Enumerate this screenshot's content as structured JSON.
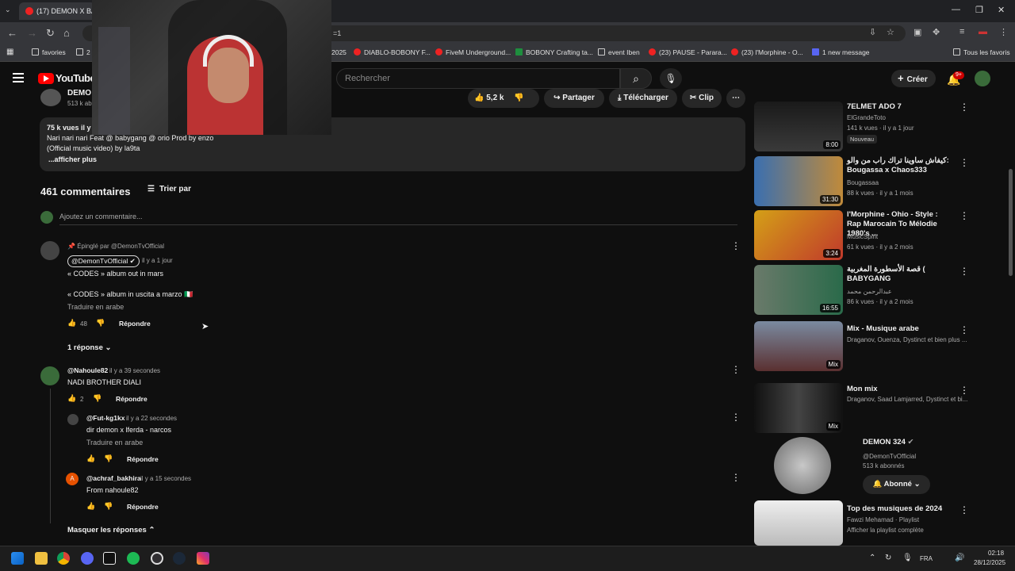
{
  "browser": {
    "tab_title": "(17) DEMON X BAB",
    "url_fragment": "=1",
    "bookmarks": [
      {
        "label": "favories"
      },
      {
        "label": "2"
      },
      {
        "label": "2025"
      },
      {
        "label": "DIABLO-BOBONY F..."
      },
      {
        "label": "FiveM Underground..."
      },
      {
        "label": "BOBONY Crafting ta..."
      },
      {
        "label": "event Iben"
      },
      {
        "label": "(23) PAUSE - Parara..."
      },
      {
        "label": "(23) l'Morphine - O..."
      },
      {
        "label": "1 new message"
      },
      {
        "label": "Tous les favoris"
      }
    ]
  },
  "youtube": {
    "logo_text": "YouTube",
    "search_placeholder": "Rechercher",
    "create_label": "Créer",
    "notif_badge": "9+"
  },
  "video": {
    "channel_partial": "DEMO",
    "subs_partial": "513 k ab",
    "likes": "5,2 k",
    "share_label": "Partager",
    "download_label": "Télécharger",
    "clip_label": "Clip",
    "views_partial": "75 k vues   il y",
    "desc_line1": "Nari nari nari Feat @ babygang  @ orio Prod by enzo",
    "desc_line2": "(Official music video) by la9ta",
    "more_label": "...afficher plus"
  },
  "comments": {
    "count_label": "461 commentaires",
    "sort_label": "Trier par",
    "add_placeholder": "Ajoutez un commentaire...",
    "pinned_label": "Épinglé par @DemonTvOfficial",
    "c1_author": "@DemonTvOfficial",
    "c1_time": "il y a 1 jour",
    "c1_line1": "« CODES » album out in mars",
    "c1_line2": "« CODES » album in uscita a marzo 🇮🇹",
    "c1_translate": "Traduire en arabe",
    "c1_likes": "48",
    "reply_label": "Répondre",
    "c1_replies": "1 réponse",
    "c2_author": "@Nahoule82",
    "c2_time": "il y a 39 secondes",
    "c2_text": "NADI BROTHER DIALI",
    "c2_likes": "2",
    "r1_author": "@Fut-kg1kx",
    "r1_time": "il y a 22 secondes",
    "r1_text": "dir demon x lferda - narcos",
    "r1_translate": "Traduire en arabe",
    "r2_author": "@achraf_bakhira",
    "r2_time": "il y a 15 secondes",
    "r2_text": "From nahoule82",
    "r2_avatar_letter": "A",
    "hide_replies": "Masquer les réponses"
  },
  "sidebar": [
    {
      "title": "7ELMET ADO 7",
      "channel": "ElGrandeToto",
      "meta": "141 k vues · il y a 1 jour",
      "duration": "8:00",
      "badge": "Nouveau"
    },
    {
      "title": "كيفاش ساوينا تراك راب من والو: Bougassa x Chaos333",
      "channel": "Bougassaa",
      "meta": "88 k vues · il y a 1 mois",
      "duration": "31:30"
    },
    {
      "title": "l'Morphine - Ohio - Style : Rap Marocain To Mélodie 1980's ...",
      "channel": "MusicSpirit",
      "meta": "61 k vues · il y a 2 mois",
      "duration": "3:24"
    },
    {
      "title": "قصة الأسطورة المغربية ( BABYGANG",
      "channel": "عبدالرحمن محمد",
      "meta": "86 k vues · il y a 2 mois",
      "duration": "16:55"
    },
    {
      "title": "Mix - Musique arabe",
      "channel": "Draganov, Ouenza, Dystinct et bien plus ...",
      "meta": "",
      "duration": "Mix"
    },
    {
      "title": "Mon mix",
      "channel": "Draganov, Saad Lamjarred, Dystinct et bi...",
      "meta": "",
      "duration": "Mix"
    },
    {
      "title": "DEMON 324",
      "channel": "@DemonTvOfficial",
      "meta": "513 k abonnés",
      "subscribe": "Abonné"
    },
    {
      "title": "Top des musiques de 2024",
      "channel": "Fawzi Mehamad · Playlist",
      "meta": "Afficher la playlist complète",
      "duration": ""
    }
  ],
  "taskbar": {
    "lang": "FRA",
    "time": "02:18",
    "date": "28/12/2025"
  }
}
